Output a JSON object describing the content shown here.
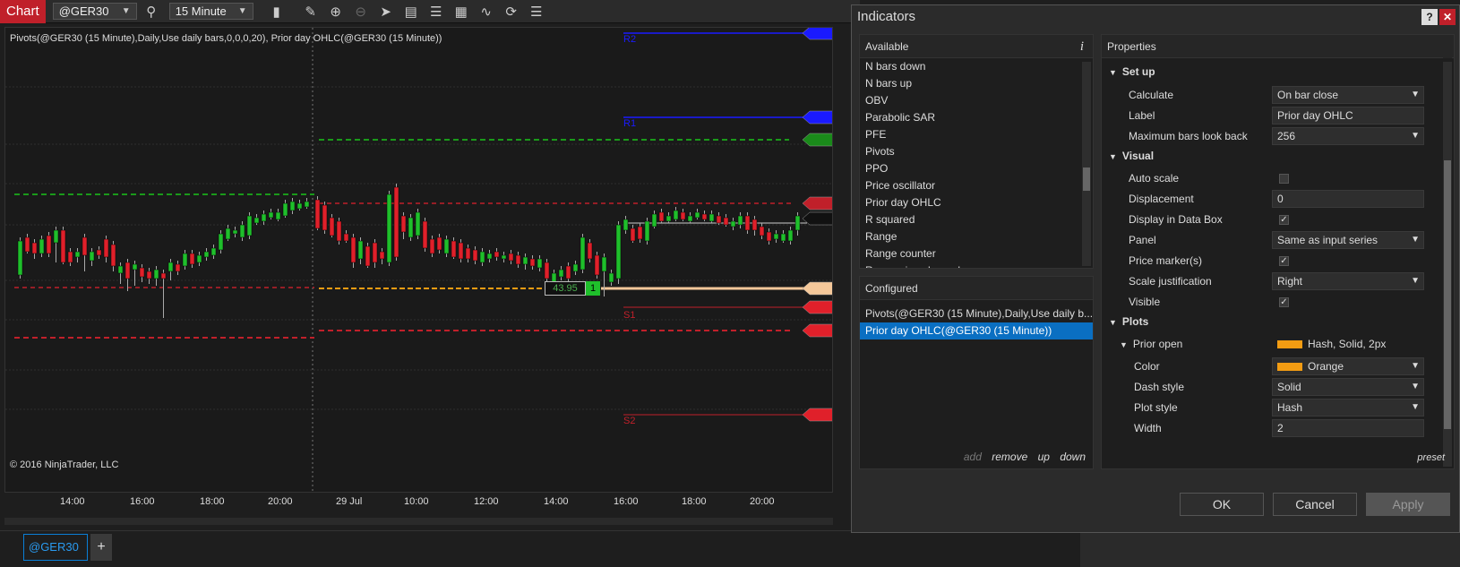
{
  "toolbar": {
    "title": "Chart",
    "instrument": "@GER30",
    "interval": "15 Minute"
  },
  "chart": {
    "label": "Pivots(@GER30 (15 Minute),Daily,Use daily bars,0,0,0,20), Prior day OHLC(@GER30 (15 Minute))",
    "copyright": "© 2016 NinjaTrader, LLC",
    "price_value": "43.95",
    "price_count": "1",
    "levels": [
      "R2",
      "R1",
      "S1",
      "S2"
    ],
    "x_ticks": [
      "14:00",
      "16:00",
      "18:00",
      "20:00",
      "29 Jul",
      "10:00",
      "12:00",
      "14:00",
      "16:00",
      "18:00",
      "20:00"
    ],
    "colors": {
      "up": "#1fbf2b",
      "down": "#e0202a",
      "pivot_green": "#1a9a1a",
      "pivot_red": "#c0202a",
      "prior_open": "#f39c12",
      "resistance": "#1a1aff"
    }
  },
  "tabs": {
    "active": "@GER30",
    "add": "+"
  },
  "dialog": {
    "title": "Indicators",
    "help": "?",
    "close": "✕",
    "available": {
      "header": "Available",
      "items": [
        "N bars down",
        "N bars up",
        "OBV",
        "Parabolic SAR",
        "PFE",
        "Pivots",
        "PPO",
        "Price oscillator",
        "Prior day OHLC",
        "R squared",
        "Range",
        "Range counter",
        "Regression channel"
      ]
    },
    "configured": {
      "header": "Configured",
      "items": [
        "Pivots(@GER30 (15 Minute),Daily,Use daily b...",
        "Prior day OHLC(@GER30 (15 Minute))"
      ],
      "actions": {
        "add": "add",
        "remove": "remove",
        "up": "up",
        "down": "down"
      }
    },
    "properties": {
      "header": "Properties",
      "setup": "Set up",
      "calculate_label": "Calculate",
      "calculate_value": "On bar close",
      "label_label": "Label",
      "label_value": "Prior day OHLC",
      "mbl_label": "Maximum bars look back",
      "mbl_value": "256",
      "visual": "Visual",
      "autoscale_label": "Auto scale",
      "displacement_label": "Displacement",
      "displacement_value": "0",
      "databox_label": "Display in Data Box",
      "panel_label": "Panel",
      "panel_value": "Same as input series",
      "marker_label": "Price marker(s)",
      "scale_label": "Scale justification",
      "scale_value": "Right",
      "visible_label": "Visible",
      "plots": "Plots",
      "prior_open_label": "Prior open",
      "prior_open_value": "Hash, Solid, 2px",
      "color_label": "Color",
      "color_value": "Orange",
      "dash_label": "Dash style",
      "dash_value": "Solid",
      "plotstyle_label": "Plot style",
      "plotstyle_value": "Hash",
      "width_label": "Width",
      "width_value": "2",
      "preset": "preset"
    },
    "buttons": {
      "ok": "OK",
      "cancel": "Cancel",
      "apply": "Apply"
    }
  }
}
